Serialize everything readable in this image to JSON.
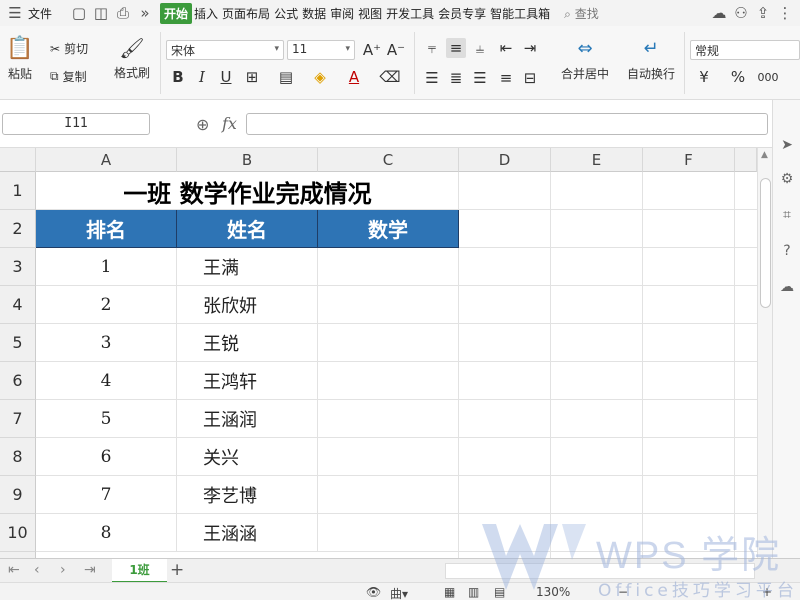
{
  "menubar": {
    "file_label": "文件",
    "tabs": [
      "开始",
      "插入",
      "页面布局",
      "公式",
      "数据",
      "审阅",
      "视图",
      "开发工具",
      "会员专享",
      "智能工具箱"
    ],
    "search_label": "查找"
  },
  "ribbon": {
    "paste": "粘贴",
    "cut": "剪切",
    "copy": "复制",
    "format_painter": "格式刷",
    "font_name": "宋体",
    "font_size": "11",
    "merge_center": "合并居中",
    "wrap_text": "自动换行",
    "number_format": "常规",
    "currency_symbol": "¥",
    "percent_symbol": "%",
    "thousands_symbol": "000",
    "bold": "B",
    "italic": "I",
    "underline": "U"
  },
  "formula_bar": {
    "name_box": "I11",
    "fx": "fx",
    "formula": ""
  },
  "sheet": {
    "columns": [
      "A",
      "B",
      "C",
      "D",
      "E",
      "F"
    ],
    "rows": [
      "1",
      "2",
      "3",
      "4",
      "5",
      "6",
      "7",
      "8",
      "9",
      "10"
    ],
    "title": "一班 数学作业完成情况",
    "headers": [
      "排名",
      "姓名",
      "数学"
    ],
    "data": [
      {
        "rank": "1",
        "name": "王满"
      },
      {
        "rank": "2",
        "name": "张欣妍"
      },
      {
        "rank": "3",
        "name": "王锐"
      },
      {
        "rank": "4",
        "name": "王鸿轩"
      },
      {
        "rank": "5",
        "name": "王涵润"
      },
      {
        "rank": "6",
        "name": "关兴"
      },
      {
        "rank": "7",
        "name": "李艺博"
      },
      {
        "rank": "8",
        "name": "王涵涵"
      }
    ]
  },
  "tabs": {
    "sheet_name": "1班",
    "add": "+"
  },
  "status": {
    "zoom": "130%",
    "minus": "−",
    "plus": "+"
  },
  "watermark": {
    "brand": "WPS 学院",
    "subtitle": "Office技巧学习平台"
  },
  "colors": {
    "header_fill": "#2e74b5",
    "active_tab": "#3c9b3c"
  }
}
